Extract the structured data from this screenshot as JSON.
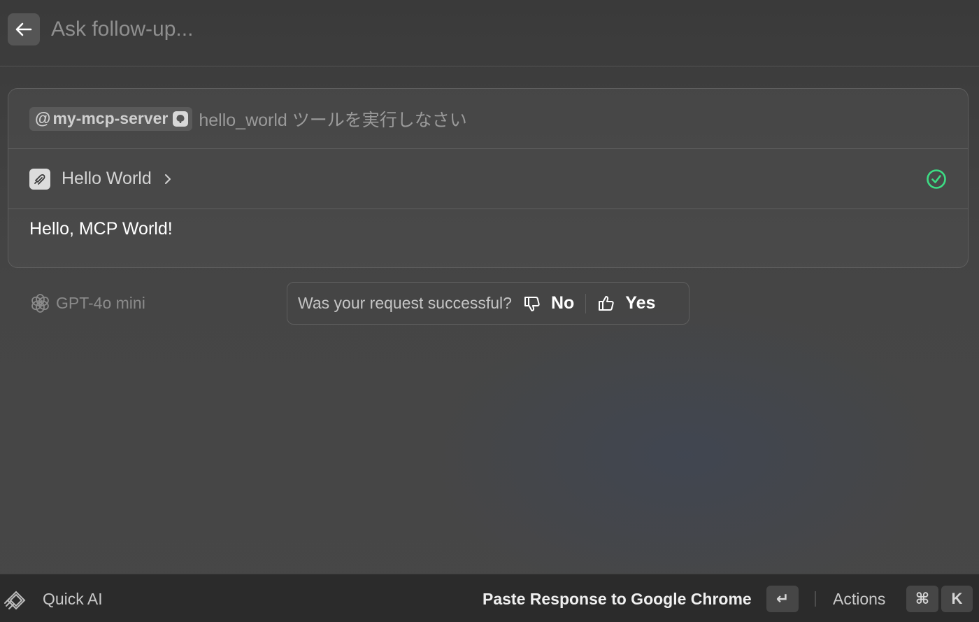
{
  "header": {
    "back_icon": "arrow-left-icon",
    "input_placeholder": "Ask follow-up..."
  },
  "conversation": {
    "mention": {
      "at": "@",
      "server_name": "my-mcp-server",
      "icon": "mcp-server-icon"
    },
    "prompt_text": "hello_world ツールを実行しなさい",
    "tool_call": {
      "icon": "mcp-tool-icon",
      "name": "Hello World",
      "chevron_icon": "chevron-right-icon",
      "status_icon": "check-circle-icon",
      "status_color": "#3ddc84"
    },
    "response": "Hello, MCP World!"
  },
  "model": {
    "icon": "openai-logo-icon",
    "name": "GPT-4o mini"
  },
  "feedback": {
    "question": "Was your request successful?",
    "no_label": "No",
    "no_icon": "thumbs-down-icon",
    "yes_label": "Yes",
    "yes_icon": "thumbs-up-icon"
  },
  "footer": {
    "app_icon": "quick-ai-logo-icon",
    "title": "Quick AI",
    "primary_action": "Paste Response to Google Chrome",
    "primary_key": "↵",
    "secondary_action": "Actions",
    "secondary_keys": [
      "⌘",
      "K"
    ]
  }
}
